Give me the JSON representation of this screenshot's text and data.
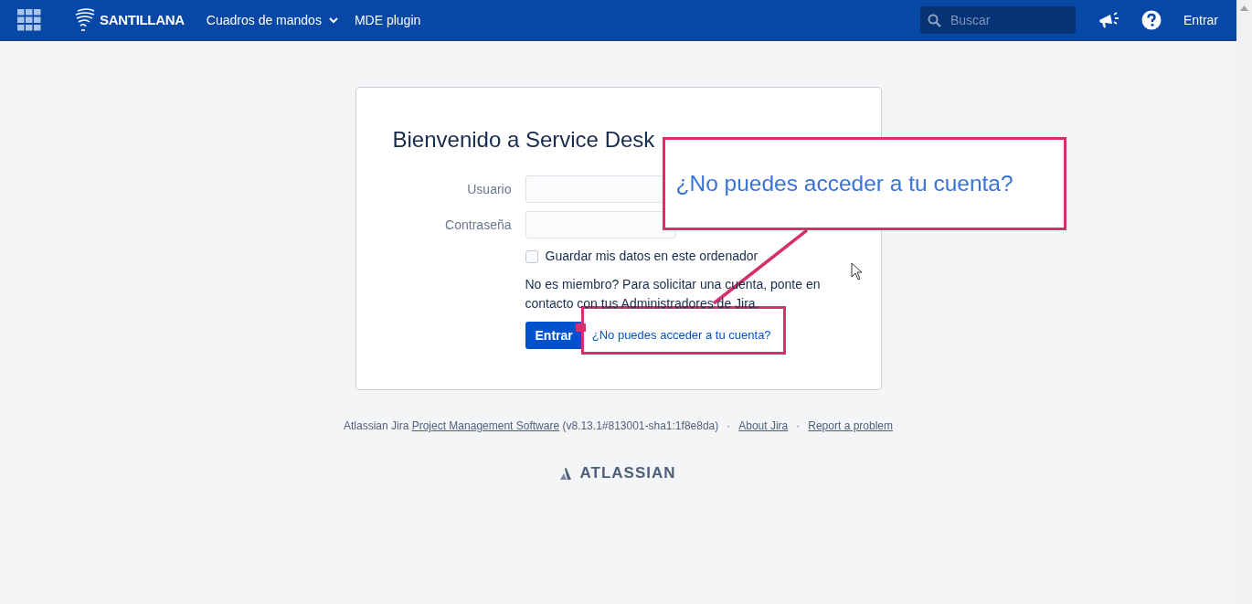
{
  "nav": {
    "brand": "SANTILLANA",
    "menu": [
      {
        "label": "Cuadros de mandos",
        "dropdown": true
      },
      {
        "label": "MDE plugin",
        "dropdown": false
      }
    ],
    "search": {
      "placeholder": "Buscar"
    },
    "login": "Entrar"
  },
  "login_card": {
    "title": "Bienvenido a Service Desk",
    "fields": [
      {
        "label": "Usuario"
      },
      {
        "label": "Contraseña"
      }
    ],
    "remember": {
      "label": "Guardar mis datos en este ordenador",
      "checked": false
    },
    "notice": "No es miembro? Para solicitar una cuenta, ponte en contacto con tus Administradores de Jira.",
    "submit": "Entrar",
    "forgot_link": "¿No puedes acceder a tu cuenta?"
  },
  "callout": {
    "text": "¿No puedes acceder a tu cuenta?"
  },
  "footer": {
    "prefix": "Atlassian Jira",
    "link": "Project Management Software",
    "version": "(v8.13.1#813001-sha1:1f8e8da)",
    "links": [
      {
        "separator": "·",
        "label": "About Jira"
      },
      {
        "separator": "·",
        "label": "Report a problem"
      }
    ],
    "logo": "ATLASSIAN"
  }
}
